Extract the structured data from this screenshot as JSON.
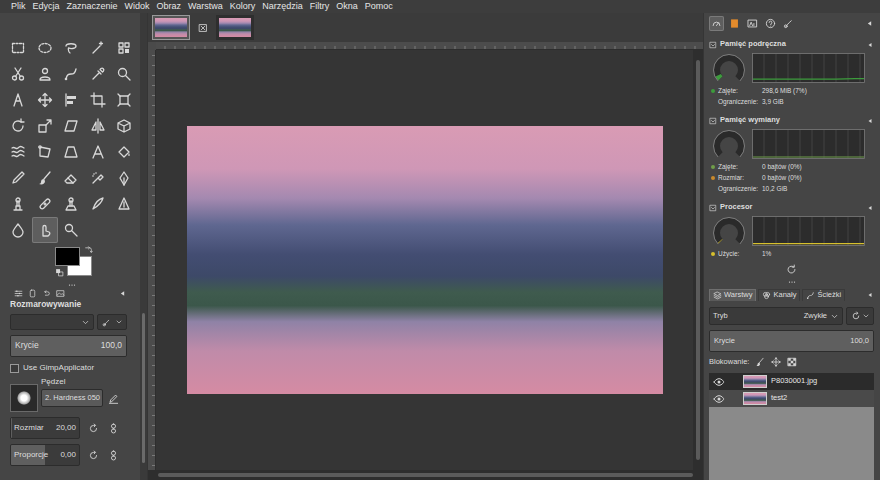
{
  "menu": [
    "Plik",
    "Edycja",
    "Zaznaczenie",
    "Widok",
    "Obraz",
    "Warstwa",
    "Kolory",
    "Narzędzia",
    "Filtry",
    "Okna",
    "Pomoc"
  ],
  "image_tabs": [
    {
      "selected": true
    },
    {
      "selected": false
    }
  ],
  "toolbox": {
    "tools": [
      {
        "selected": false
      },
      {
        "selected": false
      },
      {
        "selected": false
      },
      {
        "selected": false
      },
      {
        "selected": false
      },
      {
        "selected": false
      },
      {
        "selected": false
      },
      {
        "selected": false
      },
      {
        "selected": false
      },
      {
        "selected": false
      },
      {
        "selected": false
      },
      {
        "selected": false
      },
      {
        "selected": false
      },
      {
        "selected": false
      },
      {
        "selected": false
      },
      {
        "selected": false
      },
      {
        "selected": false
      },
      {
        "selected": false
      },
      {
        "selected": false
      },
      {
        "selected": false
      },
      {
        "selected": false
      },
      {
        "selected": false
      },
      {
        "selected": false
      },
      {
        "selected": false
      },
      {
        "selected": false
      },
      {
        "selected": false
      },
      {
        "selected": false
      },
      {
        "selected": false
      },
      {
        "selected": false
      },
      {
        "selected": false
      },
      {
        "selected": false
      },
      {
        "selected": false
      },
      {
        "selected": false
      },
      {
        "selected": false
      },
      {
        "selected": false
      },
      {
        "selected": false
      },
      {
        "selected": true
      },
      {
        "selected": false
      }
    ],
    "foreground": "#000000",
    "background": "#ffffff"
  },
  "tool_options": {
    "title": "Rozmarowywanie",
    "opacity": {
      "label": "Krycie",
      "value": "100,0",
      "level": 1
    },
    "applicator": {
      "label": "Use GimpApplicator",
      "checked": false
    },
    "brush": {
      "label": "Pędzel",
      "name": "2. Hardness 050"
    },
    "size": {
      "label": "Rozmiar",
      "value": "20,00",
      "level": 0.02
    },
    "aspect": {
      "label": "Proporcje",
      "value": "0,00",
      "level": 0.5
    }
  },
  "dock_tabs": [
    {
      "selected": true
    },
    {
      "selected": false
    },
    {
      "selected": false
    },
    {
      "selected": false
    },
    {
      "selected": false
    }
  ],
  "dashboard": {
    "sections": [
      {
        "title": "Pamięć podręczna",
        "level": 0.07,
        "history": [
          7,
          7,
          7,
          7,
          7,
          7,
          7,
          7,
          7,
          7,
          8,
          9,
          9
        ],
        "rows": [
          {
            "label": "Zajęte:",
            "value": "298,6 MiB (7%)",
            "color": "#3d9c3d"
          },
          {
            "label": "Ograniczenie:",
            "value": "3,9 GiB"
          }
        ]
      },
      {
        "title": "Pamięć wymiany",
        "level": 0,
        "history": [
          0,
          0,
          0,
          0,
          0,
          0,
          0,
          0,
          0,
          0,
          0,
          0,
          0
        ],
        "rows": [
          {
            "label": "Zajęte:",
            "value": "0 bajtów (0%)",
            "color": "#6f9e4a"
          },
          {
            "label": "Rozmiar:",
            "value": "0 bajtów (0%)",
            "color": "#c98a2b"
          },
          {
            "label": "Ograniczenie:",
            "value": "10,2 GiB"
          }
        ]
      },
      {
        "title": "Procesor",
        "level": 0.01,
        "history": [
          1,
          1,
          2,
          1,
          1,
          1,
          1,
          1,
          2,
          1,
          1,
          1,
          1
        ],
        "rows": [
          {
            "label": "Użycie:",
            "value": "1%",
            "color": "#d6c02e"
          }
        ]
      }
    ]
  },
  "layers": {
    "tabs": [
      {
        "label": "Warstwy",
        "selected": true
      },
      {
        "label": "Kanały",
        "selected": false
      },
      {
        "label": "Ścieżki",
        "selected": false
      }
    ],
    "mode": {
      "label": "Tryb",
      "value": "Zwykłe"
    },
    "opacity": {
      "label": "Krycie",
      "value": "100,0",
      "level": 1
    },
    "lock_label": "Blokowanie:",
    "items": [
      {
        "name": "P8030001.jpg",
        "visible": true,
        "selected": true
      },
      {
        "name": "test2",
        "visible": true,
        "selected": false
      }
    ]
  }
}
